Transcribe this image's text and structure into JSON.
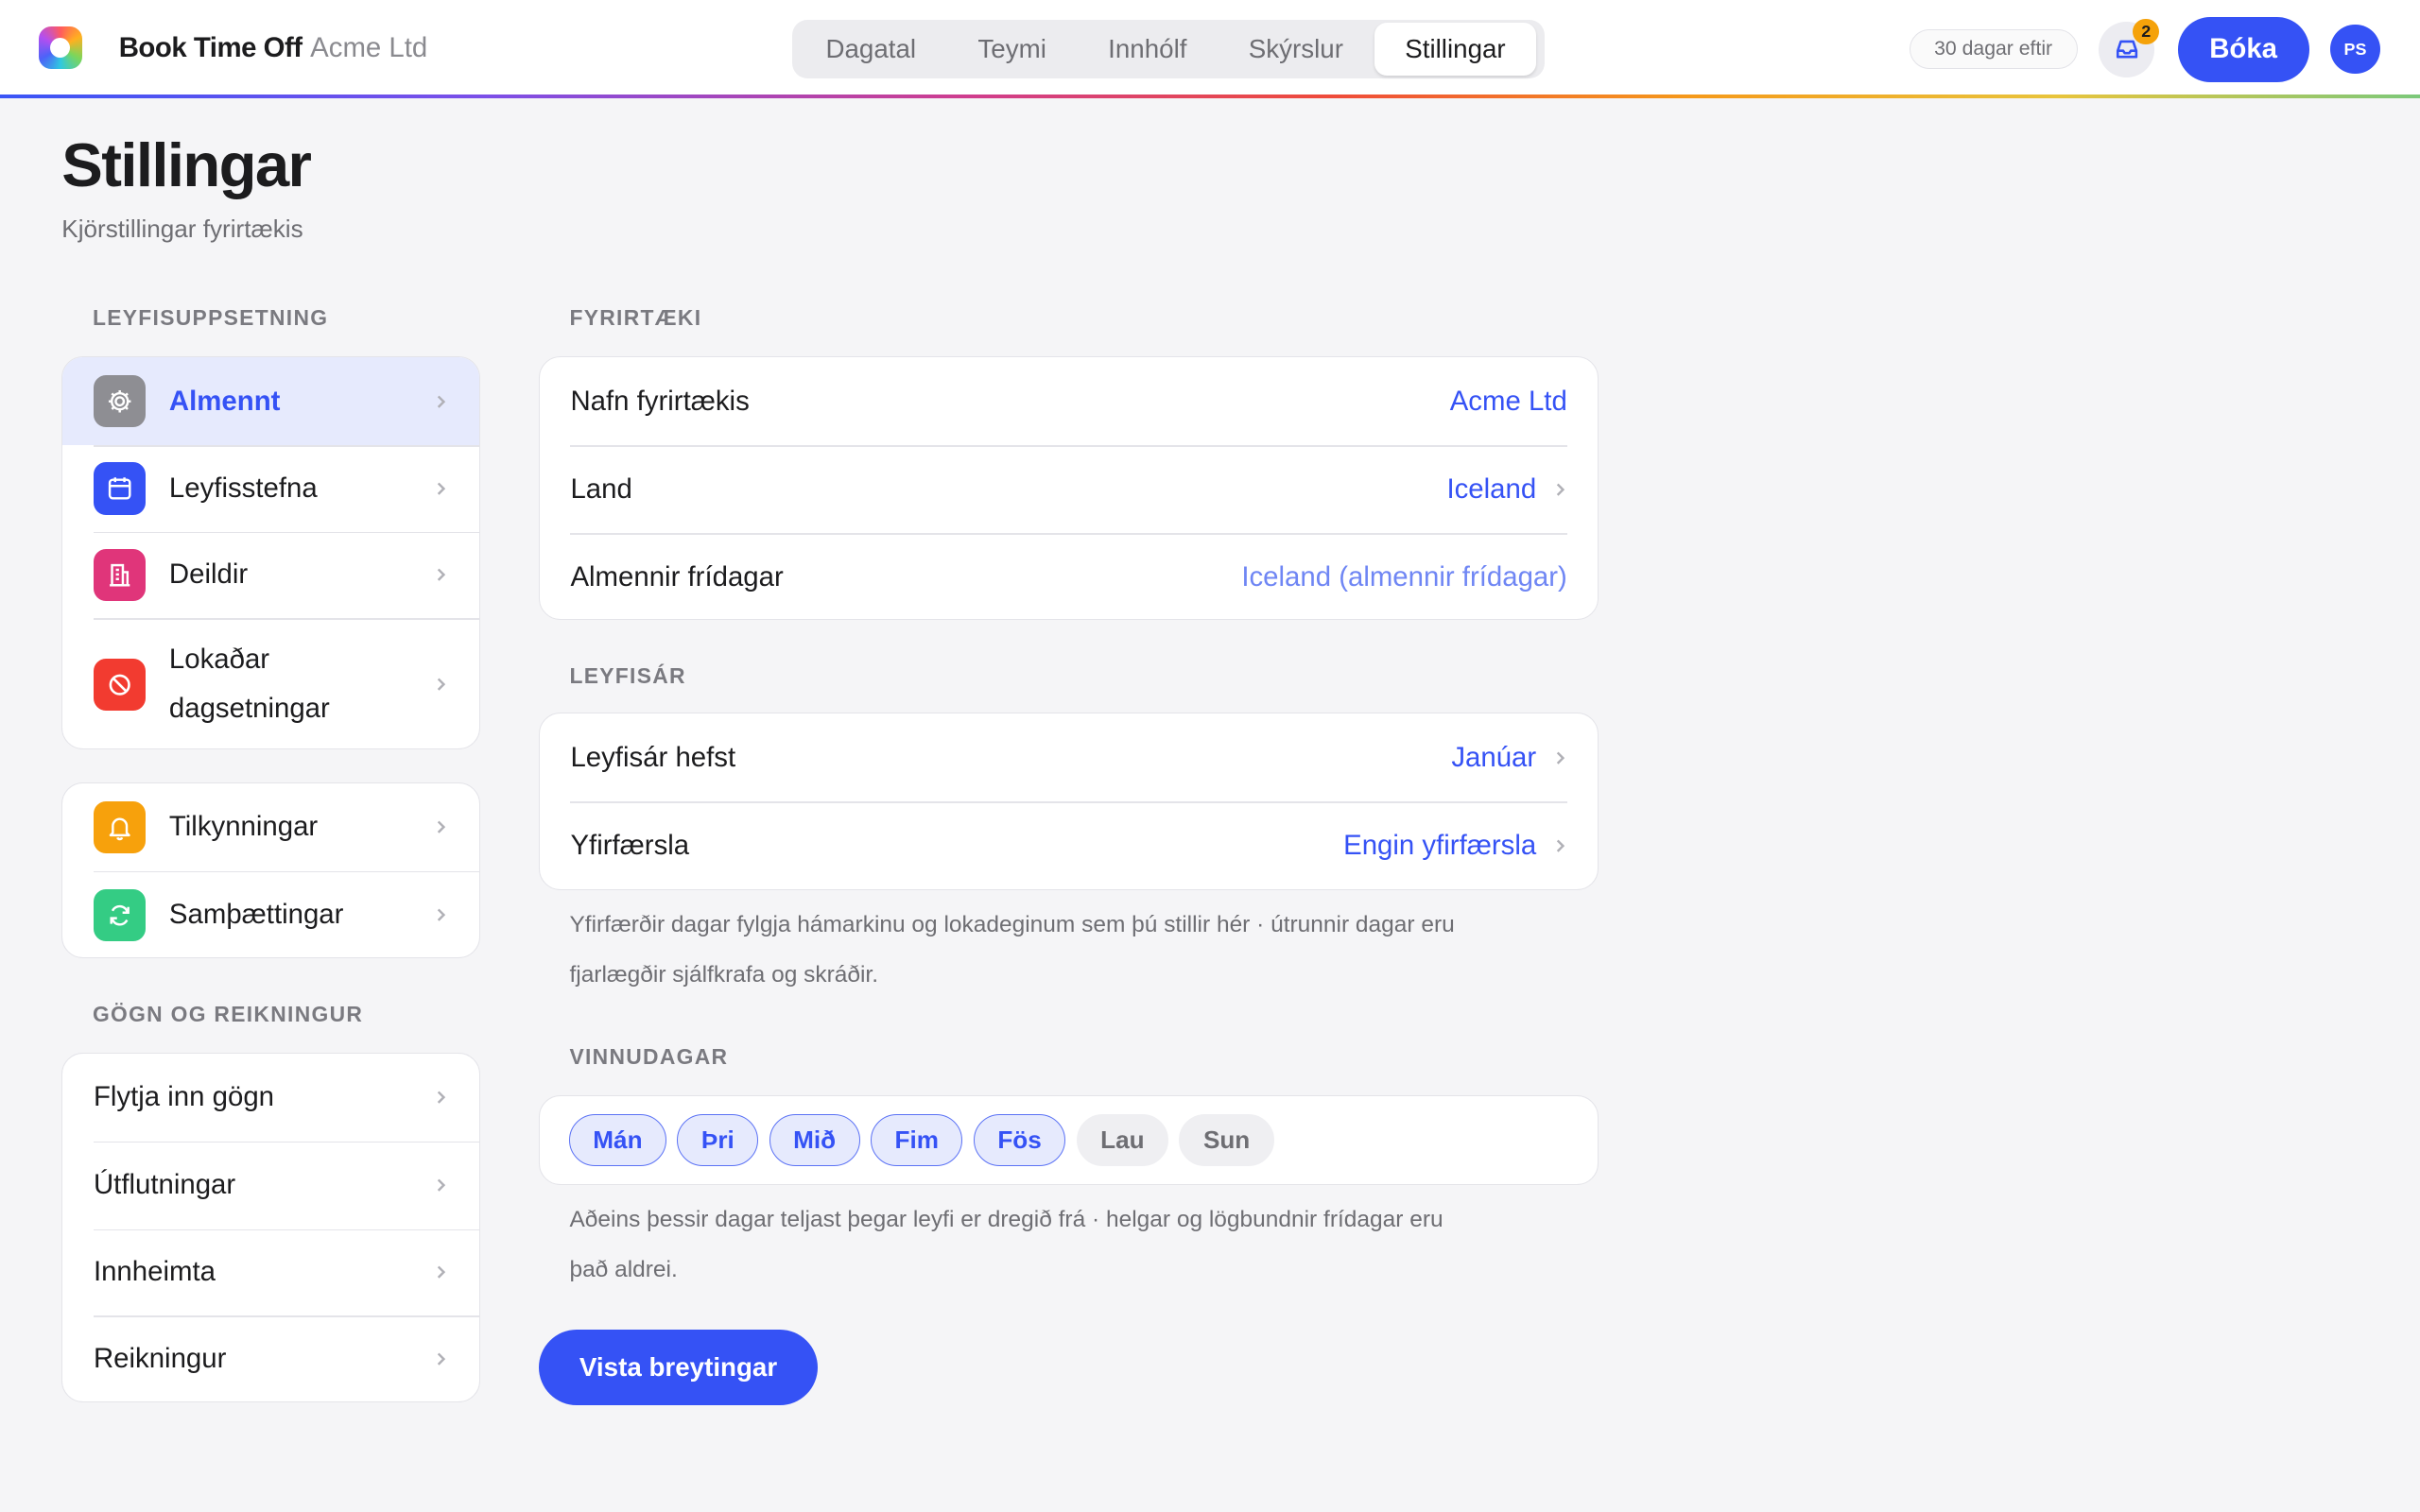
{
  "app": {
    "name": "Book Time Off",
    "org": "Acme Ltd"
  },
  "nav": {
    "tabs": [
      {
        "label": "Dagatal",
        "active": false
      },
      {
        "label": "Teymi",
        "active": false
      },
      {
        "label": "Innhólf",
        "active": false
      },
      {
        "label": "Skýrslur",
        "active": false
      },
      {
        "label": "Stillingar",
        "active": true
      }
    ]
  },
  "header": {
    "days_left": "30 dagar eftir",
    "inbox_count": "2",
    "book_label": "Bóka",
    "avatar_initials": "PS"
  },
  "page": {
    "title": "Stillingar",
    "subtitle": "Kjörstillingar fyrirtækis"
  },
  "sidebar": {
    "section1": "LEYFISUPPSETNING",
    "group1": [
      {
        "label": "Almennt",
        "icon": "gear-icon",
        "color": "#8e8e93",
        "active": true
      },
      {
        "label": "Leyfisstefna",
        "icon": "calendar-icon",
        "color": "#3552f5",
        "active": false
      },
      {
        "label": "Deildir",
        "icon": "building-icon",
        "color": "#e0357a",
        "active": false
      },
      {
        "label": "Lokaðar dagsetningar",
        "icon": "blocked-icon",
        "color": "#f23b30",
        "active": false
      }
    ],
    "group2": [
      {
        "label": "Tilkynningar",
        "icon": "bell-icon",
        "color": "#f7a10c"
      },
      {
        "label": "Samþættingar",
        "icon": "sync-icon",
        "color": "#34cc84"
      }
    ],
    "section2": "GÖGN OG REIKNINGUR",
    "group3": [
      {
        "label": "Flytja inn gögn"
      },
      {
        "label": "Útflutningar"
      },
      {
        "label": "Innheimta"
      },
      {
        "label": "Reikningur"
      }
    ]
  },
  "company": {
    "section": "FYRIRTÆKI",
    "rows": [
      {
        "label": "Nafn fyrirtækis",
        "value": "Acme Ltd"
      },
      {
        "label": "Land",
        "value": "Iceland"
      },
      {
        "label": "Almennir frídagar",
        "value": "Iceland (almennir frídagar)"
      }
    ]
  },
  "leave_year": {
    "section": "LEYFISÁR",
    "rows": [
      {
        "label": "Leyfisár hefst",
        "value": "Janúar"
      },
      {
        "label": "Yfirfærsla",
        "value": "Engin yfirfærsla"
      }
    ],
    "help": "Yfirfærðir dagar fylgja hámarkinu og lokadeginum sem þú stillir hér · útrunnir dagar eru fjarlægðir sjálfkrafa og skráðir."
  },
  "workdays": {
    "section": "VINNUDAGAR",
    "days": [
      {
        "label": "Mán",
        "on": true
      },
      {
        "label": "Þri",
        "on": true
      },
      {
        "label": "Mið",
        "on": true
      },
      {
        "label": "Fim",
        "on": true
      },
      {
        "label": "Fös",
        "on": true
      },
      {
        "label": "Lau",
        "on": false
      },
      {
        "label": "Sun",
        "on": false
      }
    ],
    "help": "Aðeins þessir dagar teljast þegar leyfi er dregið frá · helgar og lögbundnir frídagar eru það aldrei."
  },
  "save_label": "Vista breytingar",
  "colors": {
    "accent": "#3552f5",
    "accent_soft": "#e6eafd",
    "badge": "#f5a20a"
  }
}
